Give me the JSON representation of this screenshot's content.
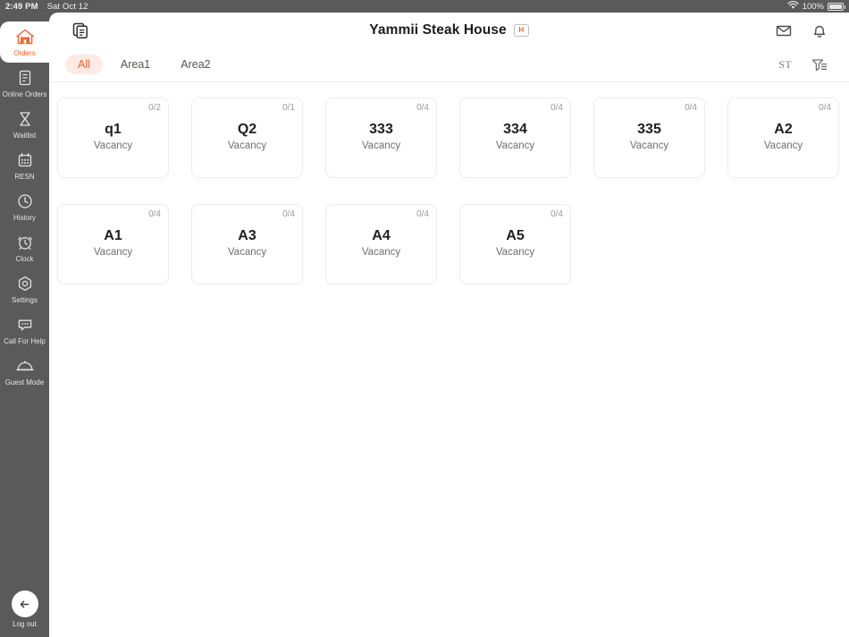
{
  "statusbar": {
    "time": "2:49 PM",
    "date": "Sat Oct 12",
    "wifi_icon": "wifi-icon",
    "battery_percent": "100%",
    "battery_icon": "battery-full-icon"
  },
  "header": {
    "copy_icon": "copy-documents-icon",
    "title": "Yammii Steak House",
    "badge_label": "H",
    "mail_icon": "mail-envelope-icon",
    "bell_icon": "notification-bell-icon"
  },
  "tabs": {
    "items": [
      {
        "label": "All",
        "active": true
      },
      {
        "label": "Area1",
        "active": false
      },
      {
        "label": "Area2",
        "active": false
      }
    ],
    "sort_label": "ST",
    "filter_icon": "filter-funnel-icon"
  },
  "sidebar": {
    "items": [
      {
        "label": "Orders",
        "icon": "home-icon",
        "active": true
      },
      {
        "label": "Online Orders",
        "icon": "document-lines-icon",
        "active": false
      },
      {
        "label": "Waitlist",
        "icon": "hourglass-icon",
        "active": false
      },
      {
        "label": "RESN",
        "icon": "calendar-icon",
        "active": false
      },
      {
        "label": "History",
        "icon": "clock-icon",
        "active": false
      },
      {
        "label": "Clock",
        "icon": "alarm-clock-icon",
        "active": false
      },
      {
        "label": "Settings",
        "icon": "gear-icon",
        "active": false
      },
      {
        "label": "Call For Help",
        "icon": "speech-bubble-icon",
        "active": false
      },
      {
        "label": "Guest Mode",
        "icon": "food-cloche-icon",
        "active": false
      }
    ],
    "logout": {
      "label": "Log out",
      "icon": "arrow-left-icon"
    }
  },
  "tables": [
    {
      "name": "q1",
      "capacity": "0/2",
      "status": "Vacancy"
    },
    {
      "name": "Q2",
      "capacity": "0/1",
      "status": "Vacancy"
    },
    {
      "name": "333",
      "capacity": "0/4",
      "status": "Vacancy"
    },
    {
      "name": "334",
      "capacity": "0/4",
      "status": "Vacancy"
    },
    {
      "name": "335",
      "capacity": "0/4",
      "status": "Vacancy"
    },
    {
      "name": "A2",
      "capacity": "0/4",
      "status": "Vacancy"
    },
    {
      "name": "A1",
      "capacity": "0/4",
      "status": "Vacancy"
    },
    {
      "name": "A3",
      "capacity": "0/4",
      "status": "Vacancy"
    },
    {
      "name": "A4",
      "capacity": "0/4",
      "status": "Vacancy"
    },
    {
      "name": "A5",
      "capacity": "0/4",
      "status": "Vacancy"
    }
  ],
  "colors": {
    "accent": "#f4622e",
    "accent_soft": "#fdeae3",
    "sidebar_bg": "#5a5a5a",
    "panel_bg": "#ffffff",
    "card_border": "#ececec"
  }
}
